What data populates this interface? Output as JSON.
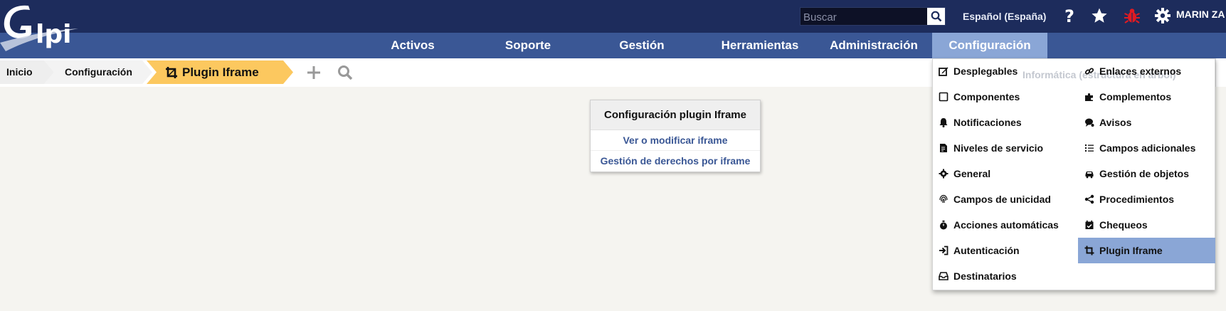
{
  "header": {
    "logo_text": "Glpi",
    "search_placeholder": "Buscar",
    "language": "Español (España)",
    "user": "MARIN ZA",
    "icons": [
      "help-icon",
      "star-icon",
      "bug-icon",
      "gear-icon"
    ]
  },
  "nav": {
    "items": [
      {
        "label": "Activos"
      },
      {
        "label": "Soporte"
      },
      {
        "label": "Gestión"
      },
      {
        "label": "Herramientas"
      },
      {
        "label": "Administración"
      },
      {
        "label": "Configuración"
      }
    ],
    "active": "Configuración"
  },
  "breadcrumb": {
    "items": [
      "Inicio",
      "Configuración",
      "Plugin Iframe"
    ]
  },
  "card": {
    "title": "Configuración plugin Iframe",
    "links": [
      "Ver o modificar iframe",
      "Gestión de derechos por iframe"
    ]
  },
  "behind_text": "Informática (estructura en árbol)",
  "menu": {
    "left": [
      {
        "label": "Desplegables",
        "icon": "edit-icon"
      },
      {
        "label": "Componentes",
        "icon": "square-icon"
      },
      {
        "label": "Notificaciones",
        "icon": "bell-icon"
      },
      {
        "label": "Niveles de servicio",
        "icon": "file-contract-icon"
      },
      {
        "label": "General",
        "icon": "cog-icon"
      },
      {
        "label": "Campos de unicidad",
        "icon": "fingerprint-icon"
      },
      {
        "label": "Acciones automáticas",
        "icon": "stopwatch-icon"
      },
      {
        "label": "Autenticación",
        "icon": "sign-in-icon"
      },
      {
        "label": "Destinatarios",
        "icon": "inbox-icon"
      }
    ],
    "right": [
      {
        "label": "Enlaces externos",
        "icon": "link-icon"
      },
      {
        "label": "Complementos",
        "icon": "puzzle-icon"
      },
      {
        "label": "Avisos",
        "icon": "comment-icon"
      },
      {
        "label": "Campos adicionales",
        "icon": "list-icon"
      },
      {
        "label": "Gestión de objetos",
        "icon": "car-icon"
      },
      {
        "label": "Procedimientos",
        "icon": "share-icon"
      },
      {
        "label": "Chequeos",
        "icon": "calendar-check-icon"
      },
      {
        "label": "Plugin Iframe",
        "icon": "crop-icon",
        "selected": true
      }
    ]
  },
  "colors": {
    "header_bg": "#1d2c5c",
    "nav_bg": "#3a5795",
    "nav_active": "#8aa6d6",
    "crumb_active": "#fcc85f",
    "link": "#3a5795"
  }
}
